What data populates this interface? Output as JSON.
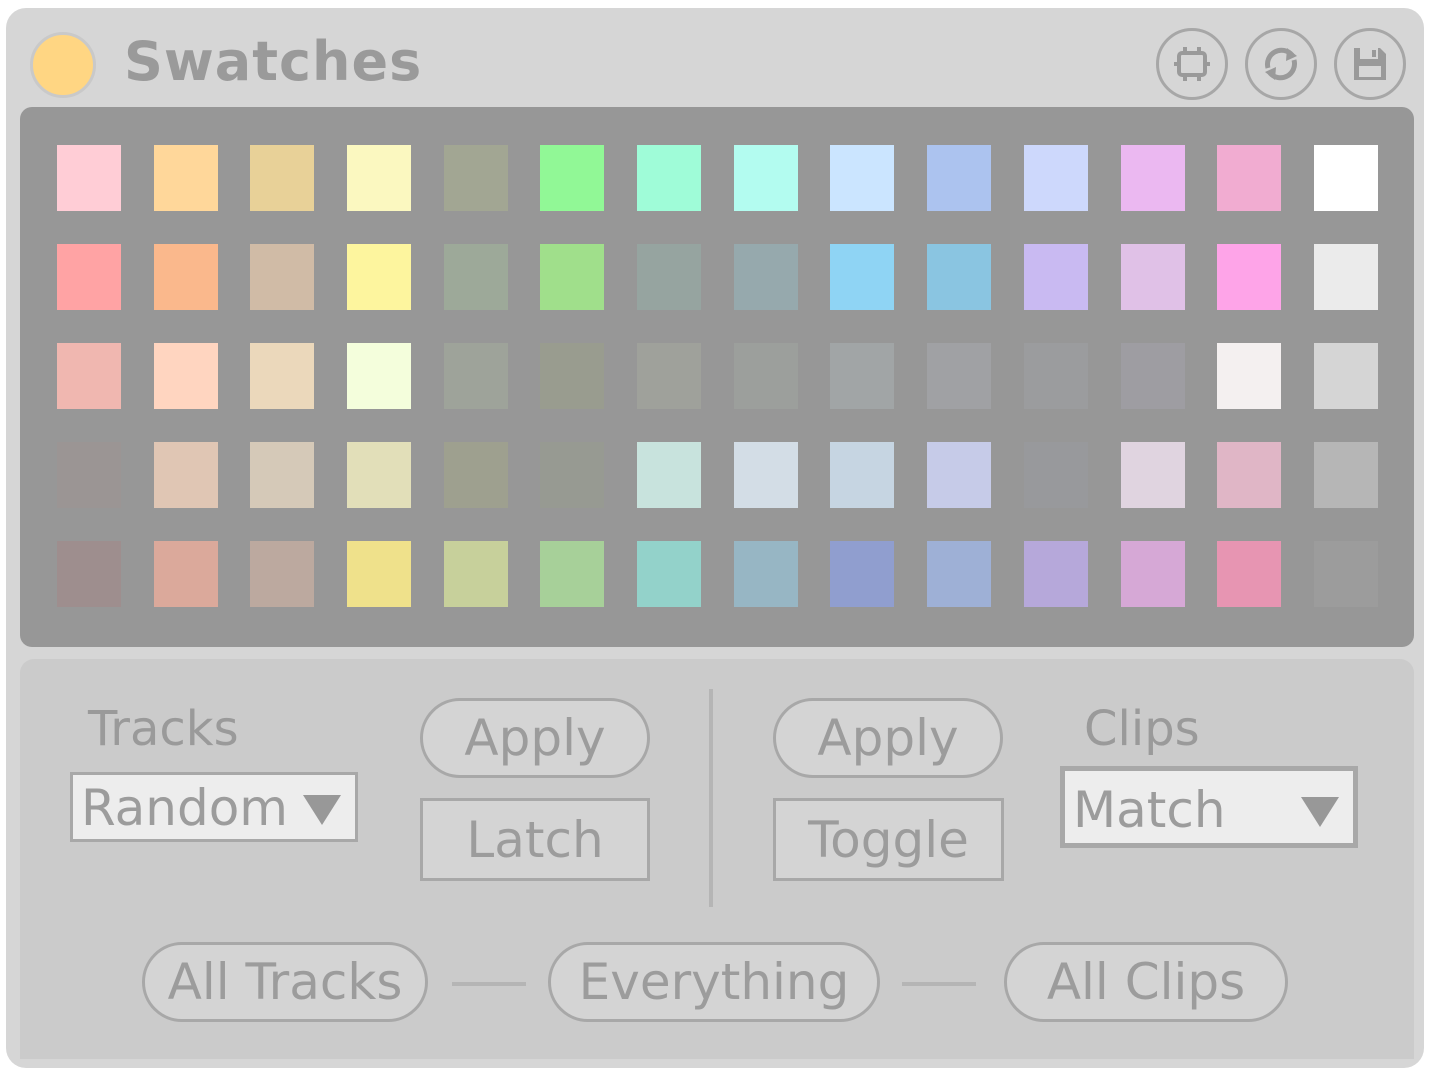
{
  "header": {
    "title": "Swatches",
    "power_color": "#ffd683",
    "buttons": [
      {
        "icon": "frame-icon"
      },
      {
        "icon": "refresh-icon"
      },
      {
        "icon": "save-icon"
      }
    ]
  },
  "swatches": [
    [
      "#ffcdd6",
      "#ffd79a",
      "#e8d198",
      "#fbf8c0",
      "#a2a693",
      "#91f896",
      "#9ffcd8",
      "#b3fcf0",
      "#cbe5ff",
      "#acc3ef",
      "#cdd8fc",
      "#ebb8f1",
      "#f1acd1",
      "#ffffff"
    ],
    [
      "#ffa3a4",
      "#fab88c",
      "#d0bba6",
      "#fdf59e",
      "#9da999",
      "#a0df8b",
      "#96a4a0",
      "#96a9ad",
      "#8fd4f4",
      "#8ac5e1",
      "#c9baf2",
      "#e0c1e7",
      "#fea4e8",
      "#ebebeb"
    ],
    [
      "#f0b7b0",
      "#ffd5c0",
      "#ebd8bb",
      "#f4fedc",
      "#9ea39a",
      "#999c8f",
      "#9fa19b",
      "#9c9f9c",
      "#a1a5a6",
      "#a0a1a4",
      "#9b9c9e",
      "#9e9da2",
      "#f4f0f0",
      "#d5d5d5"
    ],
    [
      "#9b9594",
      "#e0c6b4",
      "#d5c9b8",
      "#e2dfb9",
      "#9ea08f",
      "#979a92",
      "#c8e3dd",
      "#d3dde6",
      "#c6d5e2",
      "#c6cbe8",
      "#98999c",
      "#e0d4e0",
      "#e0b6c6",
      "#b6b6b6"
    ],
    [
      "#9e8e8e",
      "#dba99b",
      "#bca99f",
      "#efe18b",
      "#c7d09b",
      "#a7d099",
      "#93d2ca",
      "#97b6c4",
      "#909ecf",
      "#9eb0d6",
      "#b6a8da",
      "#d6a8d6",
      "#e795b2",
      "#9c9c9c"
    ]
  ],
  "tracks": {
    "label": "Tracks",
    "mode": "Random",
    "apply_label": "Apply",
    "latch_label": "Latch"
  },
  "clips": {
    "label": "Clips",
    "mode": "Match",
    "apply_label": "Apply",
    "toggle_label": "Toggle"
  },
  "bottom": {
    "all_tracks_label": "All Tracks",
    "everything_label": "Everything",
    "all_clips_label": "All Clips"
  }
}
